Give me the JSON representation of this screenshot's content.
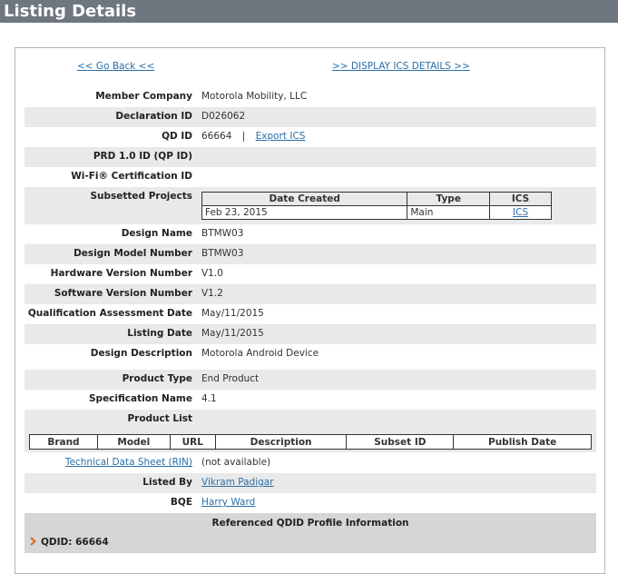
{
  "header": {
    "title": "Listing Details"
  },
  "nav": {
    "go_back": "<< Go Back <<",
    "display_ics": ">> DISPLAY ICS DETAILS >>"
  },
  "details": {
    "member_company": {
      "label": "Member Company",
      "value": "Motorola Mobility, LLC"
    },
    "declaration_id": {
      "label": "Declaration ID",
      "value": "D026062"
    },
    "qd_id": {
      "label": "QD ID",
      "value": "66664",
      "separator": "|",
      "link": "Export ICS"
    },
    "prd_id": {
      "label": "PRD 1.0 ID (QP ID)",
      "value": ""
    },
    "wifi_cert": {
      "label": "Wi-Fi® Certification ID",
      "value": ""
    },
    "subsetted_projects": {
      "label": "Subsetted Projects",
      "columns": [
        "Date Created",
        "Type",
        "ICS"
      ],
      "rows": [
        {
          "date_created": "Feb 23, 2015",
          "type": "Main",
          "ics": "ICS"
        }
      ]
    },
    "design_name": {
      "label": "Design Name",
      "value": "BTMW03"
    },
    "design_model_number": {
      "label": "Design Model Number",
      "value": "BTMW03"
    },
    "hardware_version": {
      "label": "Hardware Version Number",
      "value": "V1.0"
    },
    "software_version": {
      "label": "Software Version Number",
      "value": "V1.2"
    },
    "qa_date": {
      "label": "Qualification Assessment Date",
      "value": "May/11/2015"
    },
    "listing_date": {
      "label": "Listing Date",
      "value": "May/11/2015"
    },
    "design_description": {
      "label": "Design Description",
      "value": "Motorola Android Device"
    },
    "product_type": {
      "label": "Product Type",
      "value": "End Product"
    },
    "spec_name": {
      "label": "Specification Name",
      "value": "4.1"
    },
    "product_list": {
      "label": "Product List",
      "columns": [
        "Brand",
        "Model",
        "URL",
        "Description",
        "Subset ID",
        "Publish Date"
      ]
    },
    "tech_data_sheet": {
      "link": "Technical Data Sheet (RIN)",
      "value": "(not available)"
    },
    "listed_by": {
      "label": "Listed By",
      "value": "Vikram Padigar"
    },
    "bqe": {
      "label": "BQE",
      "value": "Harry Ward"
    }
  },
  "referenced": {
    "title": "Referenced QDID Profile Information",
    "qdid": "QDID: 66664",
    "expander_icon": "chevron-right-icon",
    "expander_color": "#e0661c"
  },
  "colors": {
    "header_bg": "#6e7680",
    "link": "#2a6fa8",
    "row_shade": "#e9e9e9",
    "ref_bg": "#d6d6d6"
  }
}
